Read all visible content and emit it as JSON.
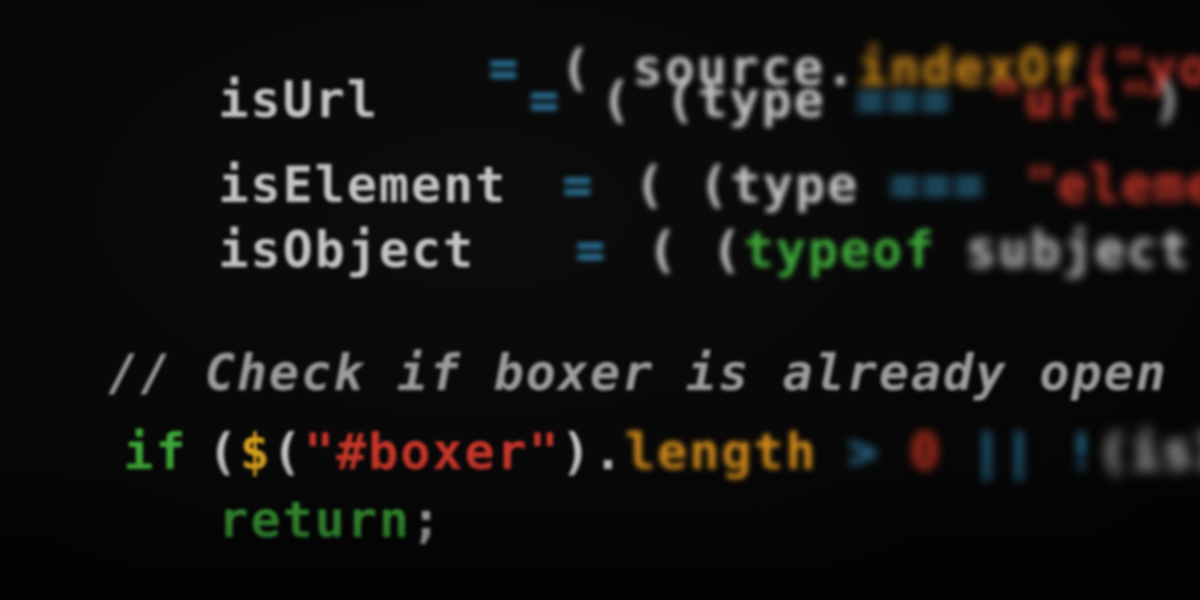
{
  "lines": {
    "l0": {
      "indent": "",
      "name": "",
      "op": "=",
      "open": "(",
      "rest": "source.",
      "method": "indexOf",
      "tail": "(\"youtube"
    },
    "l1": {
      "name": "isUrl",
      "op": "=",
      "open": "( (type",
      "eq": "===",
      "str": "\"url\"",
      "close": ")"
    },
    "l2": {
      "name": "isElement",
      "op": "=",
      "open": "( (type",
      "eq": "===",
      "str": "\"element\"",
      "close": ")"
    },
    "l3": {
      "name": "isObject",
      "op": "=",
      "open": "( (",
      "kw": "typeof",
      "rest": "subject",
      "eq": "==="
    },
    "comment": "// Check if boxer is already open",
    "ifline": {
      "kw": "if",
      "open": "(",
      "dollar": "$",
      "paren": "(",
      "str": "\"#boxer\"",
      "close": ").",
      "method": "length",
      "op": ">",
      "num": "0",
      "or": "||",
      "not": "!",
      "rest": "(isImage"
    },
    "ret": {
      "kw": "return",
      "semi": ";"
    }
  }
}
